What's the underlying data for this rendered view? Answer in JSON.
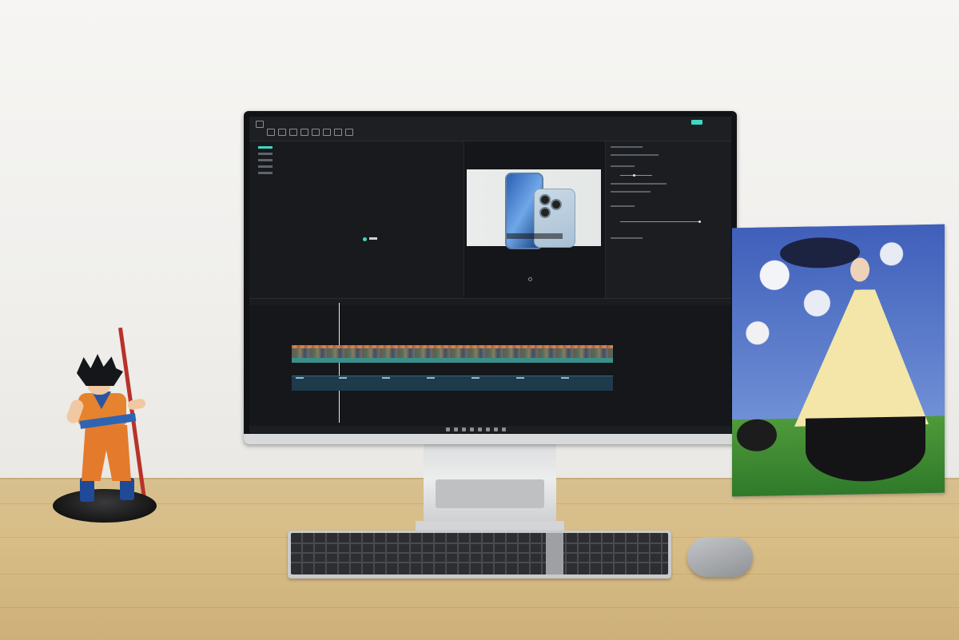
{
  "scene": {
    "description_free": true,
    "palette": {
      "wall": "#f3f2ef",
      "desk": "#d6bd8a",
      "screen_bg": "#16181c",
      "accent": "#3fd7c4"
    }
  },
  "monitor": {
    "editor_window": {
      "panels": [
        "media-panel",
        "preview-panel",
        "inspector-panel",
        "timeline-panel"
      ]
    }
  },
  "objects": {
    "icons": [
      "keyboard-icon",
      "mouse-icon",
      "figure-icon",
      "painting-icon"
    ]
  }
}
